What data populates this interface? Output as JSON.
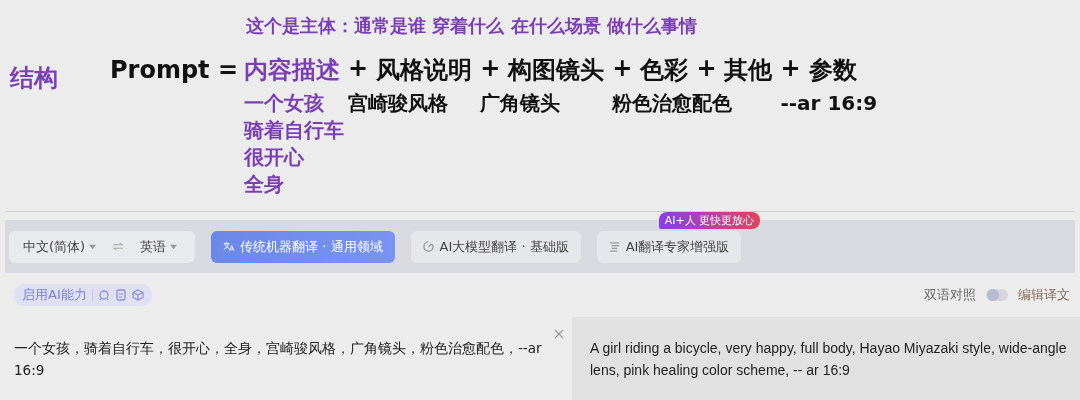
{
  "header": {
    "note": "这个是主体：通常是谁 穿着什么 在什么场景 做什么事情",
    "label": "结构",
    "lead": "Prompt =",
    "terms": [
      {
        "text": "内容描述",
        "highlight": true,
        "notes": [
          "一个女孩",
          "骑着自行车",
          "很开心",
          "全身"
        ]
      },
      {
        "prefix": "+",
        "text": "风格说明",
        "highlight": false,
        "notes": [
          "宫崎骏风格"
        ]
      },
      {
        "prefix": "+",
        "text": "构图镜头",
        "highlight": false,
        "notes": [
          "广角镜头"
        ]
      },
      {
        "prefix": "+",
        "text": "色彩",
        "highlight": false,
        "notes": [
          "粉色治愈配色"
        ]
      },
      {
        "prefix": "+",
        "text": "其他",
        "highlight": false
      },
      {
        "prefix": "+",
        "text": "参数",
        "highlight": false,
        "notes": [
          "--ar 16:9"
        ]
      }
    ]
  },
  "translator": {
    "source_language": "中文(简体)",
    "target_language": "英语",
    "modes": [
      {
        "label": "传统机器翻译 · 通用领域",
        "selected": true
      },
      {
        "label": "AI大模型翻译 · 基础版",
        "selected": false
      },
      {
        "label": "AI翻译专家增强版",
        "selected": false,
        "badge": "AI+人 更快更放心"
      }
    ],
    "ai_label": "启用AI能力",
    "bilingual": {
      "label": "双语对照",
      "on": false
    },
    "edit_label": "编辑译文",
    "source_text": "一个女孩，骑着自行车，很开心，全身，宫崎骏风格，广角镜头，粉色治愈配色，--ar 16:9",
    "translation": "A girl riding a bicycle, very happy, full body, Hayao Miyazaki style, wide-angle lens, pink healing color scheme, -- ar 16:9"
  }
}
